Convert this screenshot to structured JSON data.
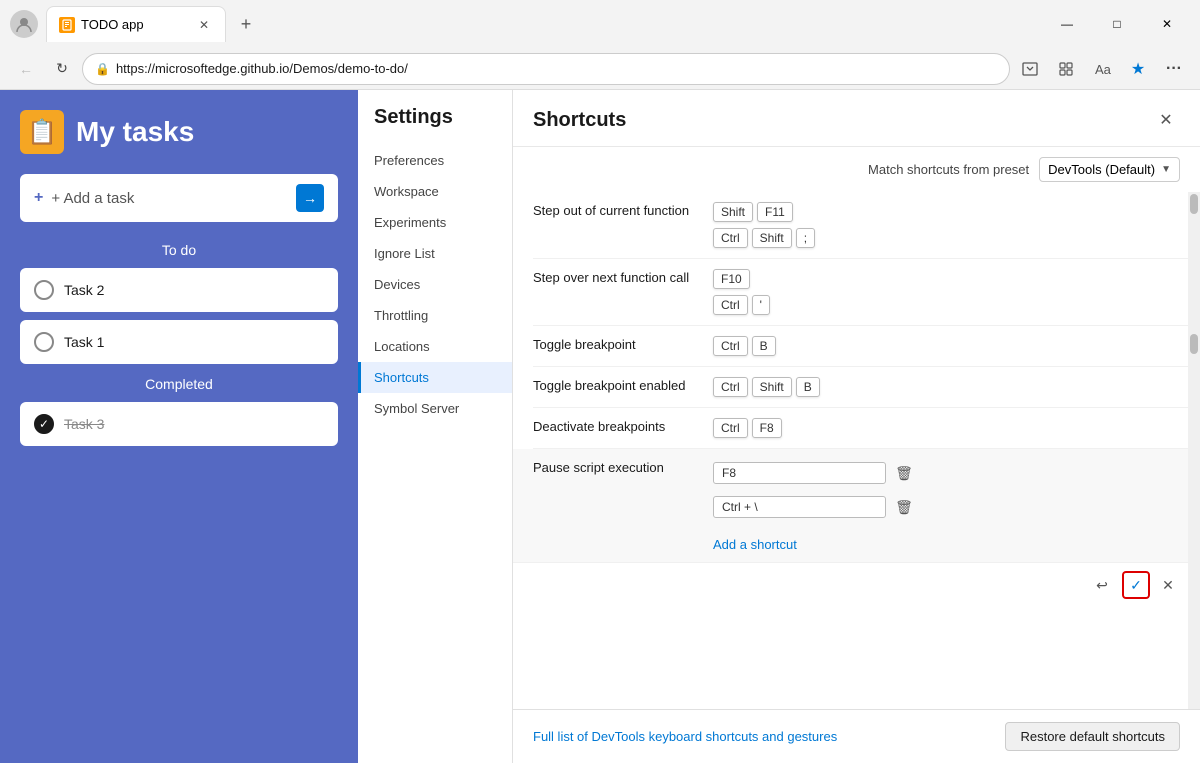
{
  "browser": {
    "tab_title": "TODO app",
    "url": "https://microsoftedge.github.io/Demos/demo-to-do/",
    "back_btn": "←",
    "refresh_btn": "↻",
    "new_tab_btn": "+",
    "win_minimize": "—",
    "win_restore": "□",
    "win_close": "✕"
  },
  "todo": {
    "title": "My tasks",
    "add_placeholder": "+ Add a task",
    "sections": {
      "todo_label": "To do",
      "completed_label": "Completed"
    },
    "tasks": [
      {
        "id": "task2",
        "text": "Task 2",
        "done": false
      },
      {
        "id": "task1",
        "text": "Task 1",
        "done": false
      }
    ],
    "completed": [
      {
        "id": "task3",
        "text": "Task 3",
        "done": true
      }
    ]
  },
  "settings": {
    "title": "Settings",
    "nav_items": [
      {
        "id": "preferences",
        "label": "Preferences"
      },
      {
        "id": "workspace",
        "label": "Workspace"
      },
      {
        "id": "experiments",
        "label": "Experiments"
      },
      {
        "id": "ignore-list",
        "label": "Ignore List"
      },
      {
        "id": "devices",
        "label": "Devices"
      },
      {
        "id": "throttling",
        "label": "Throttling"
      },
      {
        "id": "locations",
        "label": "Locations"
      },
      {
        "id": "shortcuts",
        "label": "Shortcuts"
      },
      {
        "id": "symbol-server",
        "label": "Symbol Server"
      }
    ]
  },
  "shortcuts": {
    "title": "Shortcuts",
    "close_label": "✕",
    "preset_label": "Match shortcuts from preset",
    "preset_value": "DevTools (Default)",
    "rows": [
      {
        "name": "Step out of current function",
        "combos": [
          [
            "Shift",
            "F11"
          ],
          [
            "Ctrl",
            "Shift",
            ";"
          ]
        ]
      },
      {
        "name": "Step over next function call",
        "combos": [
          [
            "F10"
          ],
          [
            "Ctrl",
            "'"
          ]
        ]
      },
      {
        "name": "Toggle breakpoint",
        "combos": [
          [
            "Ctrl",
            "B"
          ]
        ]
      },
      {
        "name": "Toggle breakpoint enabled",
        "combos": [
          [
            "Ctrl",
            "Shift",
            "B"
          ]
        ]
      },
      {
        "name": "Deactivate breakpoints",
        "combos": [
          [
            "Ctrl",
            "F8"
          ]
        ]
      }
    ],
    "editable_row": {
      "name": "Pause script execution",
      "inputs": [
        "F8",
        "Ctrl + \\"
      ]
    },
    "add_shortcut_label": "Add a shortcut",
    "undo_icon": "↩",
    "confirm_icon": "✓",
    "dismiss_icon": "✕",
    "footer_link": "Full list of DevTools keyboard shortcuts and gestures",
    "restore_btn": "Restore default shortcuts"
  }
}
